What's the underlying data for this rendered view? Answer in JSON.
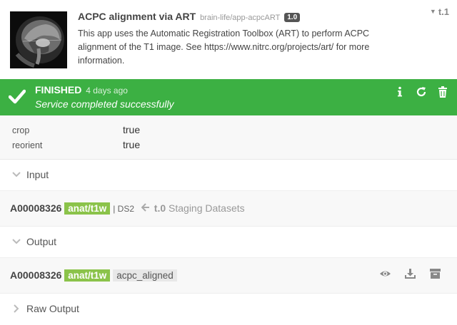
{
  "app": {
    "name": "ACPC alignment via ART",
    "repo": "brain-life/app-acpcART",
    "version": "1.0",
    "description": "This app uses the Automatic Registration Toolbox (ART) to perform ACPC alignment of the T1 image. See https://www.nitrc.org/projects/art/ for more information.",
    "task_tag": "t.1",
    "thumbnail_icon": "brain-mri-thumbnail"
  },
  "status": {
    "state": "FINISHED",
    "when": "4 days ago",
    "message": "Service completed successfully",
    "color": "#3cb043",
    "actions": [
      "info-icon",
      "rerun-icon",
      "delete-icon"
    ]
  },
  "config": [
    {
      "key": "crop",
      "value": "true"
    },
    {
      "key": "reorient",
      "value": "true"
    }
  ],
  "input": {
    "label": "Input",
    "subject": "A00008326",
    "datatype": "anat/t1w",
    "dataset": "| DS2",
    "source_task": "t.0",
    "source_name": "Staging Datasets"
  },
  "output": {
    "label": "Output",
    "subject": "A00008326",
    "datatype": "anat/t1w",
    "tag": "acpc_aligned",
    "actions": [
      "view-icon",
      "download-icon",
      "archive-icon"
    ]
  },
  "raw_output": {
    "label": "Raw Output"
  }
}
